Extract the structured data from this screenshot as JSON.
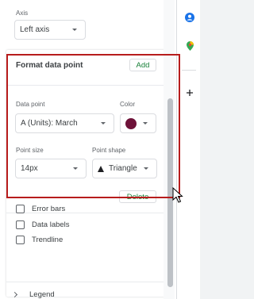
{
  "axis": {
    "label": "Axis",
    "value": "Left axis"
  },
  "format_card": {
    "title": "Format data point",
    "add_label": "Add",
    "data_point": {
      "label": "Data point",
      "value": "A (Units): March"
    },
    "color": {
      "label": "Color",
      "swatch": "#6e1239"
    },
    "point_size": {
      "label": "Point size",
      "value": "14px"
    },
    "point_shape": {
      "label": "Point shape",
      "value": "Triangle",
      "icon": "triangle-icon"
    },
    "delete_label": "Delete"
  },
  "options": [
    {
      "label": "Error bars",
      "checked": false
    },
    {
      "label": "Data labels",
      "checked": false
    },
    {
      "label": "Trendline",
      "checked": false
    }
  ],
  "legend": {
    "label": "Legend"
  },
  "colors": {
    "accent_green": "#188038",
    "highlight_red": "#b71c1c"
  },
  "right_sidebar_icons": [
    "user-icon",
    "maps-pin-icon",
    "plus-icon"
  ]
}
